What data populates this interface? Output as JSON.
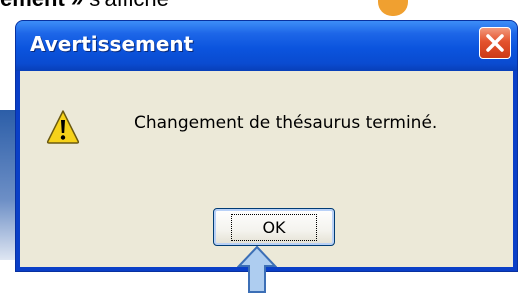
{
  "background": {
    "partial_text_bold": "ement »",
    "partial_text_rest": " s'affiche"
  },
  "dialog": {
    "title": "Avertissement",
    "message": "Changement de thésaurus terminé.",
    "ok_label": "OK",
    "icon": "warning-icon",
    "close_icon": "close-icon"
  },
  "annotation": {
    "arrow_icon": "up-arrow-icon",
    "arrow_color": "#aecdf0"
  },
  "colors": {
    "titlebar": "#0b54de",
    "client": "#ece9d8",
    "close": "#e4532d",
    "warning": "#f6d21a"
  }
}
